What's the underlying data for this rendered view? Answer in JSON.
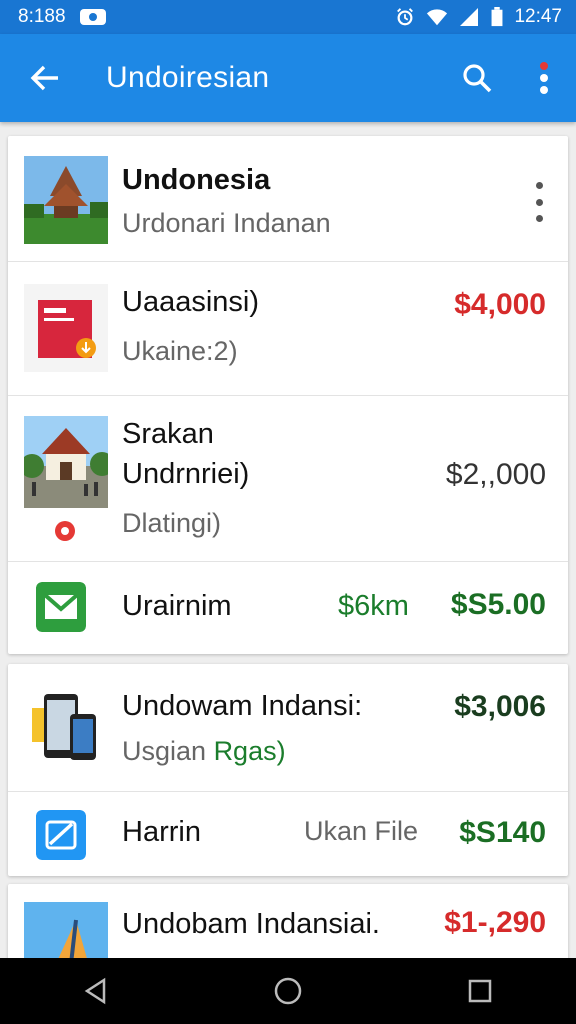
{
  "status_bar": {
    "time": "8:188",
    "clock": "12:47"
  },
  "app_bar": {
    "title": "Undoiresian"
  },
  "cards": [
    {
      "rows": [
        {
          "title": "Undonesia",
          "subtitle": "Urdonari Indanan"
        },
        {
          "title": "Uaaasinsi)",
          "subtitle": "Ukaine:2)",
          "amount": "$4,000"
        },
        {
          "title_line1": "Srakan",
          "title_line2": "Undrnriei)",
          "subtitle": "Dlatingi)",
          "amount": "$2,,000"
        },
        {
          "title": "Urairnim",
          "middle": "$6km",
          "amount": "$S5.00"
        }
      ]
    },
    {
      "rows": [
        {
          "title": "Undowam Indansi:",
          "subtitle_gray": "Usgian",
          "subtitle_green": "Rgas)",
          "amount": "$3,006"
        },
        {
          "title": "Harrin",
          "middle": "Ukan File",
          "amount": "$S140"
        }
      ]
    },
    {
      "rows": [
        {
          "title": "Undobam Indansiai.",
          "amount": "$1-,290"
        }
      ]
    }
  ],
  "icons": {
    "back": "arrow-back-icon",
    "search": "search-icon",
    "more": "more-vertical-icon",
    "nav_back": "nav-back-icon",
    "nav_home": "nav-home-icon",
    "nav_recents": "nav-recents-icon"
  },
  "colors": {
    "status_bar": "#1976d2",
    "app_bar": "#1e88e5",
    "amount_red": "#d62b2b",
    "amount_green": "#1b6e24"
  }
}
